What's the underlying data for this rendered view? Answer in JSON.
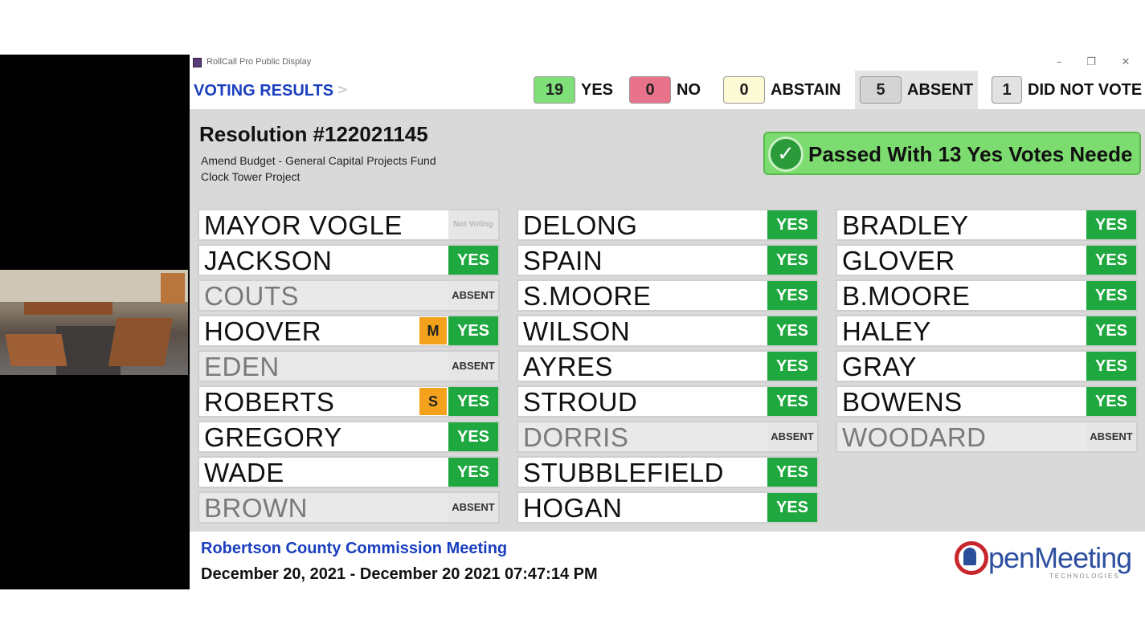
{
  "window": {
    "title": "RollCall Pro Public Display",
    "controls": {
      "minimize": "–",
      "maximize": "❐",
      "close": "✕"
    }
  },
  "header": {
    "section_title": "VOTING RESULTS",
    "chevron": ">",
    "tallies": [
      {
        "count": "19",
        "label": "YES",
        "color": "#7fe07a"
      },
      {
        "count": "0",
        "label": "NO",
        "color": "#e8728a"
      },
      {
        "count": "0",
        "label": "ABSTAIN",
        "color": "#fdfbd6"
      },
      {
        "count": "5",
        "label": "ABSENT",
        "color": "#d4d4d4"
      },
      {
        "count": "1",
        "label": "DID NOT VOTE",
        "color": "#e2e2e2"
      }
    ]
  },
  "resolution": {
    "title": "Resolution #122021145",
    "description_line1": "Amend Budget - General Capital Projects Fund",
    "description_line2": "Clock Tower Project",
    "status_text": "Passed With 13 Yes Votes Neede",
    "status_icon": "check-circle-icon"
  },
  "members": {
    "column1": [
      {
        "name": "MAYOR VOGLE",
        "vote": "Not Voting",
        "status": "notvoting",
        "tag": ""
      },
      {
        "name": "JACKSON",
        "vote": "YES",
        "status": "yes",
        "tag": ""
      },
      {
        "name": "COUTS",
        "vote": "ABSENT",
        "status": "absent",
        "tag": ""
      },
      {
        "name": "HOOVER",
        "vote": "YES",
        "status": "yes",
        "tag": "M"
      },
      {
        "name": "EDEN",
        "vote": "ABSENT",
        "status": "absent",
        "tag": ""
      },
      {
        "name": "ROBERTS",
        "vote": "YES",
        "status": "yes",
        "tag": "S"
      },
      {
        "name": "GREGORY",
        "vote": "YES",
        "status": "yes",
        "tag": ""
      },
      {
        "name": "WADE",
        "vote": "YES",
        "status": "yes",
        "tag": ""
      },
      {
        "name": "BROWN",
        "vote": "ABSENT",
        "status": "absent",
        "tag": ""
      }
    ],
    "column2": [
      {
        "name": "DELONG",
        "vote": "YES",
        "status": "yes",
        "tag": ""
      },
      {
        "name": "SPAIN",
        "vote": "YES",
        "status": "yes",
        "tag": ""
      },
      {
        "name": "S.MOORE",
        "vote": "YES",
        "status": "yes",
        "tag": ""
      },
      {
        "name": "WILSON",
        "vote": "YES",
        "status": "yes",
        "tag": ""
      },
      {
        "name": "AYRES",
        "vote": "YES",
        "status": "yes",
        "tag": ""
      },
      {
        "name": "STROUD",
        "vote": "YES",
        "status": "yes",
        "tag": ""
      },
      {
        "name": "DORRIS",
        "vote": "ABSENT",
        "status": "absent",
        "tag": ""
      },
      {
        "name": "STUBBLEFIELD",
        "vote": "YES",
        "status": "yes",
        "tag": ""
      },
      {
        "name": "HOGAN",
        "vote": "YES",
        "status": "yes",
        "tag": ""
      }
    ],
    "column3": [
      {
        "name": "BRADLEY",
        "vote": "YES",
        "status": "yes",
        "tag": ""
      },
      {
        "name": "GLOVER",
        "vote": "YES",
        "status": "yes",
        "tag": ""
      },
      {
        "name": "B.MOORE",
        "vote": "YES",
        "status": "yes",
        "tag": ""
      },
      {
        "name": "HALEY",
        "vote": "YES",
        "status": "yes",
        "tag": ""
      },
      {
        "name": "GRAY",
        "vote": "YES",
        "status": "yes",
        "tag": ""
      },
      {
        "name": "BOWENS",
        "vote": "YES",
        "status": "yes",
        "tag": ""
      },
      {
        "name": "WOODARD",
        "vote": "ABSENT",
        "status": "absent",
        "tag": ""
      }
    ]
  },
  "footer": {
    "meeting_name": "Robertson County Commission Meeting",
    "datetime": "December 20, 2021  -  December 20 2021 07:47:14 PM",
    "logo_text_o": "O",
    "logo_text_rest": "penMeeting",
    "logo_sub": "TECHNOLOGIES"
  },
  "colors": {
    "accent_blue": "#1a3fbf",
    "yes_green": "#1fa83f",
    "passed_green": "#7ddc6f",
    "tag_orange": "#f4a21c"
  }
}
